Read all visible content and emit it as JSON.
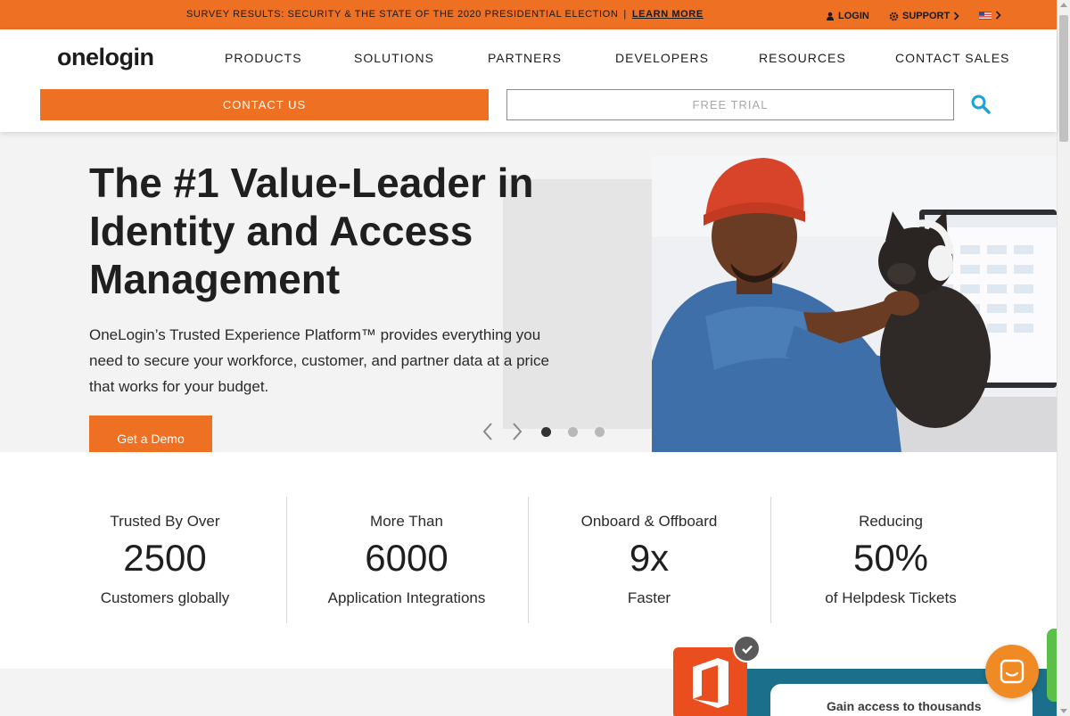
{
  "announcement": {
    "text": "SURVEY RESULTS: SECURITY & THE STATE OF THE 2020 PRESIDENTIAL ELECTION",
    "separator": "|",
    "link_label": "LEARN MORE"
  },
  "utility_nav": {
    "login_label": "LOGIN",
    "support_label": "SUPPORT",
    "language_icon": "us-flag-icon"
  },
  "brand": {
    "logo_text": "onelogin"
  },
  "nav": {
    "items": [
      "PRODUCTS",
      "SOLUTIONS",
      "PARTNERS",
      "DEVELOPERS",
      "RESOURCES",
      "CONTACT SALES"
    ]
  },
  "actions": {
    "contact_label": "CONTACT US",
    "trial_label": "FREE TRIAL",
    "search_icon": "search-icon"
  },
  "hero": {
    "title": "The #1 Value-Leader in Identity and Access Management",
    "body": "OneLogin’s Trusted Experience Platform™ provides everything you need to secure your workforce, customer, and partner data at a price that works for your budget.",
    "cta_label": "Get a Demo",
    "carousel": {
      "slide_count": 3,
      "active_index": 0
    }
  },
  "stats": [
    {
      "top": "Trusted By Over",
      "value": "2500",
      "bottom": "Customers globally"
    },
    {
      "top": "More Than",
      "value": "6000",
      "bottom": "Application Integrations"
    },
    {
      "top": "Onboard & Offboard",
      "value": "9x",
      "bottom": "Faster"
    },
    {
      "top": "Reducing",
      "value": "50%",
      "bottom": "of Helpdesk Tickets"
    }
  ],
  "promo": {
    "card_text": "Gain access to thousands"
  },
  "colors": {
    "brand_orange": "#ee7022",
    "search_blue": "#1aa3d8",
    "teal": "#1c6f8a"
  }
}
